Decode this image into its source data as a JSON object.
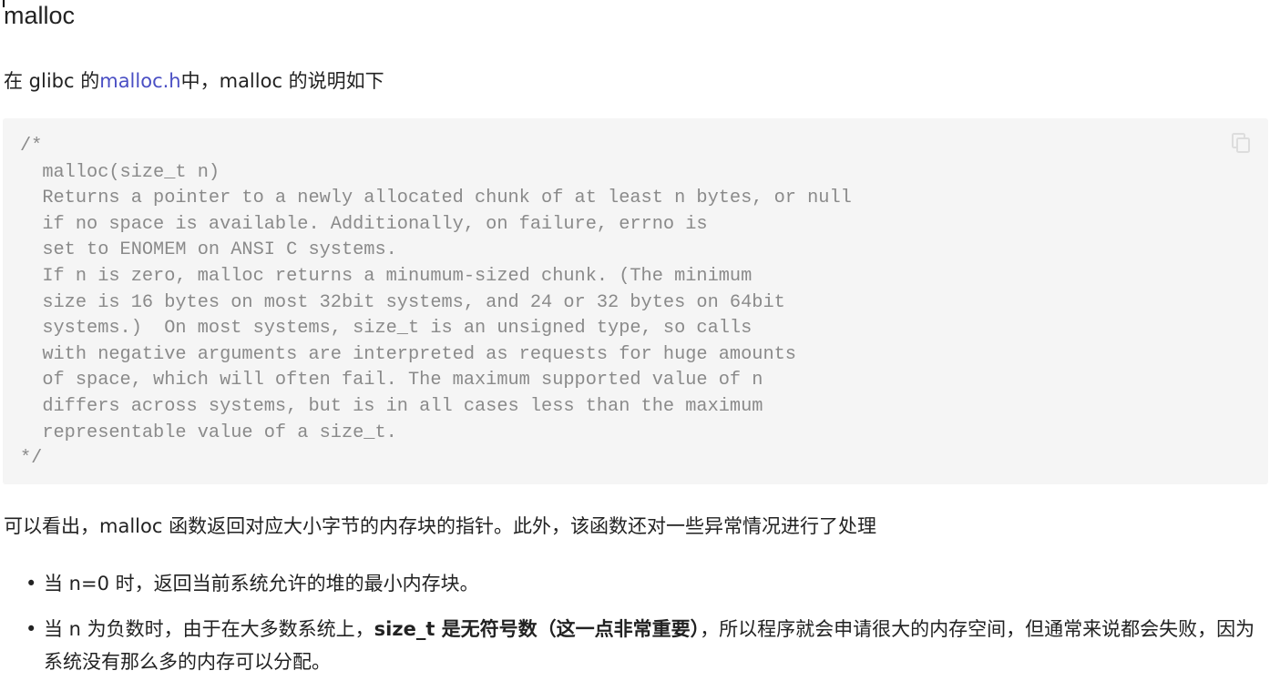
{
  "heading": "malloc",
  "intro": {
    "prefix": "在 glibc 的",
    "link": "malloc.h",
    "suffix": "中，malloc 的说明如下"
  },
  "code": "/*\n  malloc(size_t n)\n  Returns a pointer to a newly allocated chunk of at least n bytes, or null\n  if no space is available. Additionally, on failure, errno is\n  set to ENOMEM on ANSI C systems.\n  If n is zero, malloc returns a minumum-sized chunk. (The minimum\n  size is 16 bytes on most 32bit systems, and 24 or 32 bytes on 64bit\n  systems.)  On most systems, size_t is an unsigned type, so calls\n  with negative arguments are interpreted as requests for huge amounts\n  of space, which will often fail. The maximum supported value of n\n  differs across systems, but is in all cases less than the maximum\n  representable value of a size_t.\n*/",
  "summary": "可以看出，malloc 函数返回对应大小字节的内存块的指针。此外，该函数还对一些异常情况进行了处理",
  "bullets": {
    "b1": "当 n=0 时，返回当前系统允许的堆的最小内存块。",
    "b2_pre": "当 n 为负数时，由于在大多数系统上，",
    "b2_bold": "size_t 是无符号数（这一点非常重要）",
    "b2_post": "，所以程序就会申请很大的内存空间，但通常来说都会失败，因为系统没有那么多的内存可以分配。",
    "dot": "•"
  }
}
